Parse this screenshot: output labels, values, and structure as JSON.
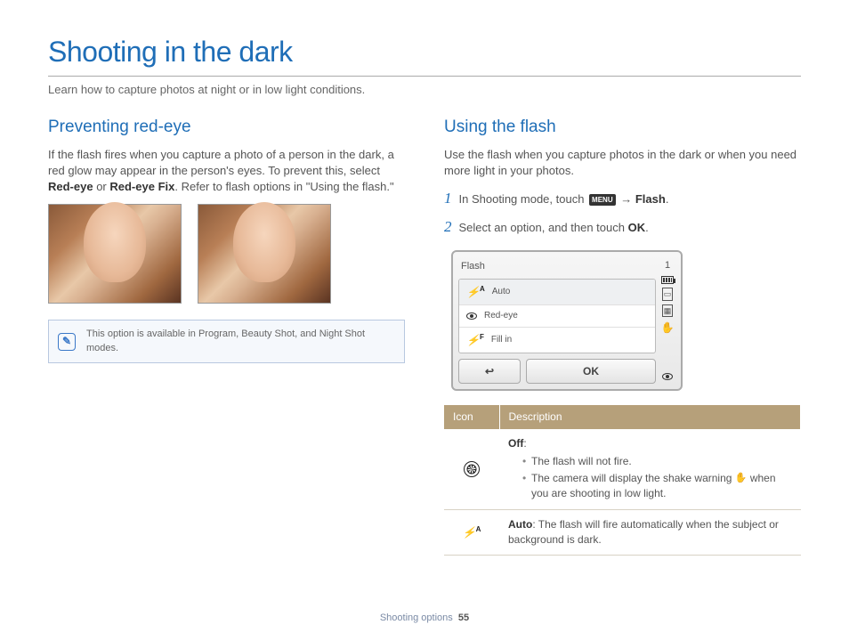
{
  "page": {
    "title": "Shooting in the dark",
    "intro": "Learn how to capture photos at night or in low light conditions.",
    "footer_section": "Shooting options",
    "footer_page": "55"
  },
  "left": {
    "heading": "Preventing red-eye",
    "p1a": "If the flash fires when you capture a photo of a person in the dark, a red glow may appear in the person's eyes. To prevent this, select ",
    "p1_bold1": "Red-eye",
    "p1_mid": " or ",
    "p1_bold2": "Red-eye Fix",
    "p1b": ". Refer to flash options in \"Using the flash.\"",
    "note": "This option is available in Program, Beauty Shot, and Night Shot modes."
  },
  "right": {
    "heading": "Using the flash",
    "p1": "Use the flash when you capture photos in the dark or when you need more light in your photos.",
    "step1a": "In Shooting mode, touch ",
    "step1_menu": "MENU",
    "step1_arrow": " → ",
    "step1_bold": "Flash",
    "step1_end": ".",
    "step2a": "Select an option, and then touch ",
    "step2_ok": "OK",
    "step2_end": ".",
    "cam": {
      "title": "Flash",
      "count": "1",
      "items": [
        "Auto",
        "Red-eye",
        "Fill in"
      ],
      "back": "↩",
      "ok": "OK"
    },
    "table": {
      "h1": "Icon",
      "h2": "Description",
      "rows": [
        {
          "icon": "off",
          "title": "Off",
          "bullets": [
            "The flash will not fire.",
            "The camera will display the shake warning   when you are shooting in low light."
          ]
        },
        {
          "icon": "auto",
          "title": "Auto",
          "text": ": The flash will fire automatically when the subject or background is dark."
        }
      ]
    }
  }
}
